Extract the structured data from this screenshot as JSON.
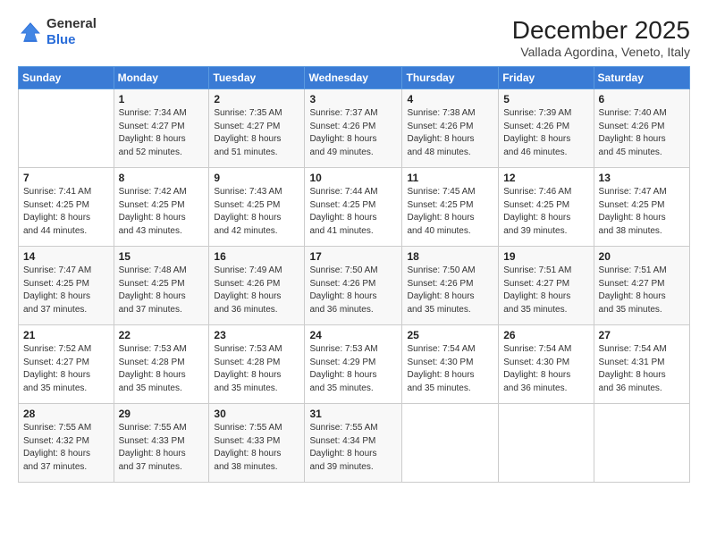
{
  "logo": {
    "general": "General",
    "blue": "Blue"
  },
  "header": {
    "month": "December 2025",
    "location": "Vallada Agordina, Veneto, Italy"
  },
  "weekdays": [
    "Sunday",
    "Monday",
    "Tuesday",
    "Wednesday",
    "Thursday",
    "Friday",
    "Saturday"
  ],
  "weeks": [
    [
      {
        "day": "",
        "info": ""
      },
      {
        "day": "1",
        "info": "Sunrise: 7:34 AM\nSunset: 4:27 PM\nDaylight: 8 hours\nand 52 minutes."
      },
      {
        "day": "2",
        "info": "Sunrise: 7:35 AM\nSunset: 4:27 PM\nDaylight: 8 hours\nand 51 minutes."
      },
      {
        "day": "3",
        "info": "Sunrise: 7:37 AM\nSunset: 4:26 PM\nDaylight: 8 hours\nand 49 minutes."
      },
      {
        "day": "4",
        "info": "Sunrise: 7:38 AM\nSunset: 4:26 PM\nDaylight: 8 hours\nand 48 minutes."
      },
      {
        "day": "5",
        "info": "Sunrise: 7:39 AM\nSunset: 4:26 PM\nDaylight: 8 hours\nand 46 minutes."
      },
      {
        "day": "6",
        "info": "Sunrise: 7:40 AM\nSunset: 4:26 PM\nDaylight: 8 hours\nand 45 minutes."
      }
    ],
    [
      {
        "day": "7",
        "info": "Sunrise: 7:41 AM\nSunset: 4:25 PM\nDaylight: 8 hours\nand 44 minutes."
      },
      {
        "day": "8",
        "info": "Sunrise: 7:42 AM\nSunset: 4:25 PM\nDaylight: 8 hours\nand 43 minutes."
      },
      {
        "day": "9",
        "info": "Sunrise: 7:43 AM\nSunset: 4:25 PM\nDaylight: 8 hours\nand 42 minutes."
      },
      {
        "day": "10",
        "info": "Sunrise: 7:44 AM\nSunset: 4:25 PM\nDaylight: 8 hours\nand 41 minutes."
      },
      {
        "day": "11",
        "info": "Sunrise: 7:45 AM\nSunset: 4:25 PM\nDaylight: 8 hours\nand 40 minutes."
      },
      {
        "day": "12",
        "info": "Sunrise: 7:46 AM\nSunset: 4:25 PM\nDaylight: 8 hours\nand 39 minutes."
      },
      {
        "day": "13",
        "info": "Sunrise: 7:47 AM\nSunset: 4:25 PM\nDaylight: 8 hours\nand 38 minutes."
      }
    ],
    [
      {
        "day": "14",
        "info": "Sunrise: 7:47 AM\nSunset: 4:25 PM\nDaylight: 8 hours\nand 37 minutes."
      },
      {
        "day": "15",
        "info": "Sunrise: 7:48 AM\nSunset: 4:25 PM\nDaylight: 8 hours\nand 37 minutes."
      },
      {
        "day": "16",
        "info": "Sunrise: 7:49 AM\nSunset: 4:26 PM\nDaylight: 8 hours\nand 36 minutes."
      },
      {
        "day": "17",
        "info": "Sunrise: 7:50 AM\nSunset: 4:26 PM\nDaylight: 8 hours\nand 36 minutes."
      },
      {
        "day": "18",
        "info": "Sunrise: 7:50 AM\nSunset: 4:26 PM\nDaylight: 8 hours\nand 35 minutes."
      },
      {
        "day": "19",
        "info": "Sunrise: 7:51 AM\nSunset: 4:27 PM\nDaylight: 8 hours\nand 35 minutes."
      },
      {
        "day": "20",
        "info": "Sunrise: 7:51 AM\nSunset: 4:27 PM\nDaylight: 8 hours\nand 35 minutes."
      }
    ],
    [
      {
        "day": "21",
        "info": "Sunrise: 7:52 AM\nSunset: 4:27 PM\nDaylight: 8 hours\nand 35 minutes."
      },
      {
        "day": "22",
        "info": "Sunrise: 7:53 AM\nSunset: 4:28 PM\nDaylight: 8 hours\nand 35 minutes."
      },
      {
        "day": "23",
        "info": "Sunrise: 7:53 AM\nSunset: 4:28 PM\nDaylight: 8 hours\nand 35 minutes."
      },
      {
        "day": "24",
        "info": "Sunrise: 7:53 AM\nSunset: 4:29 PM\nDaylight: 8 hours\nand 35 minutes."
      },
      {
        "day": "25",
        "info": "Sunrise: 7:54 AM\nSunset: 4:30 PM\nDaylight: 8 hours\nand 35 minutes."
      },
      {
        "day": "26",
        "info": "Sunrise: 7:54 AM\nSunset: 4:30 PM\nDaylight: 8 hours\nand 36 minutes."
      },
      {
        "day": "27",
        "info": "Sunrise: 7:54 AM\nSunset: 4:31 PM\nDaylight: 8 hours\nand 36 minutes."
      }
    ],
    [
      {
        "day": "28",
        "info": "Sunrise: 7:55 AM\nSunset: 4:32 PM\nDaylight: 8 hours\nand 37 minutes."
      },
      {
        "day": "29",
        "info": "Sunrise: 7:55 AM\nSunset: 4:33 PM\nDaylight: 8 hours\nand 37 minutes."
      },
      {
        "day": "30",
        "info": "Sunrise: 7:55 AM\nSunset: 4:33 PM\nDaylight: 8 hours\nand 38 minutes."
      },
      {
        "day": "31",
        "info": "Sunrise: 7:55 AM\nSunset: 4:34 PM\nDaylight: 8 hours\nand 39 minutes."
      },
      {
        "day": "",
        "info": ""
      },
      {
        "day": "",
        "info": ""
      },
      {
        "day": "",
        "info": ""
      }
    ]
  ]
}
